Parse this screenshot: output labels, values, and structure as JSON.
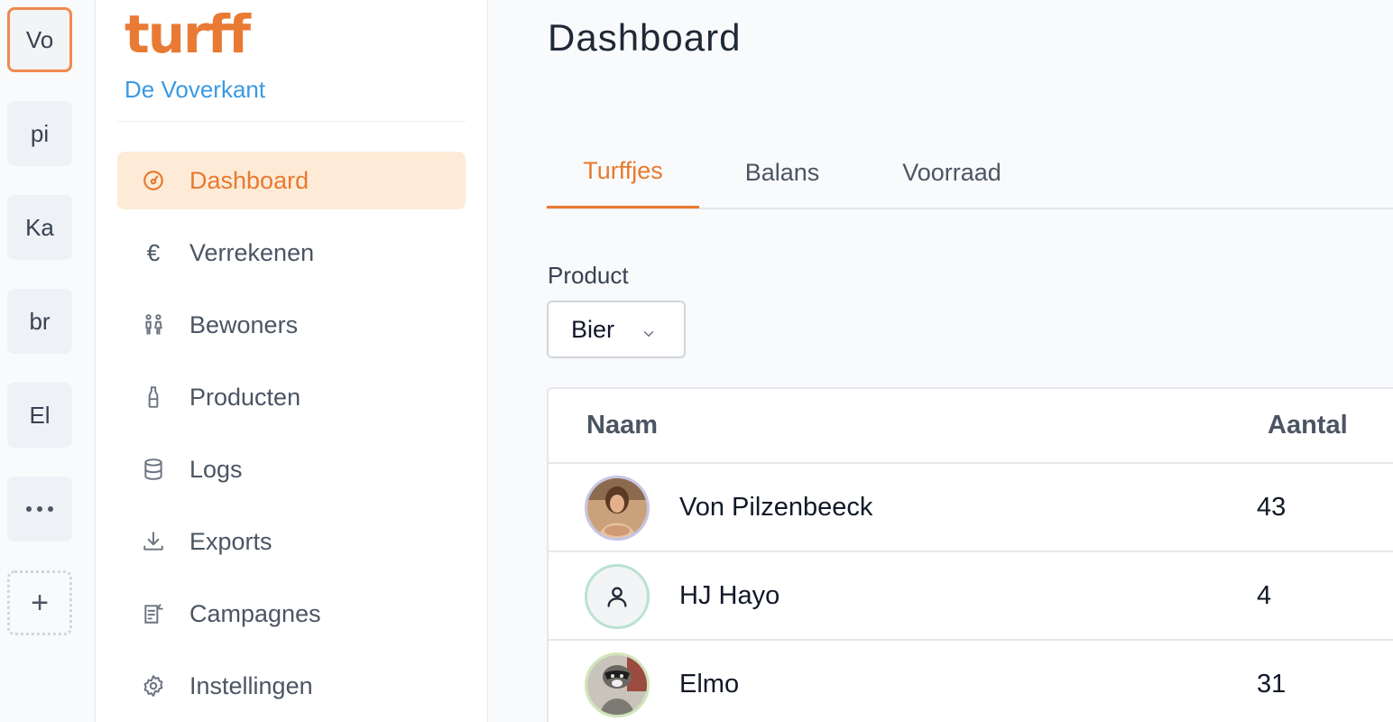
{
  "rail": {
    "groups": [
      {
        "abbr": "Vo",
        "active": true
      },
      {
        "abbr": "pi",
        "active": false
      },
      {
        "abbr": "Ka",
        "active": false
      },
      {
        "abbr": "br",
        "active": false
      },
      {
        "abbr": "El",
        "active": false
      }
    ],
    "more_icon": "ellipsis-icon",
    "add_icon": "plus-icon",
    "add_label": "+"
  },
  "sidebar": {
    "logo_text": "turff",
    "org_name": "De Voverkant",
    "nav": [
      {
        "label": "Dashboard",
        "icon": "gauge-icon",
        "active": true
      },
      {
        "label": "Verrekenen",
        "icon": "euro-icon",
        "icon_glyph": "€",
        "active": false
      },
      {
        "label": "Bewoners",
        "icon": "people-icon",
        "active": false
      },
      {
        "label": "Producten",
        "icon": "bottle-icon",
        "active": false
      },
      {
        "label": "Logs",
        "icon": "database-icon",
        "active": false
      },
      {
        "label": "Exports",
        "icon": "download-icon",
        "active": false
      },
      {
        "label": "Campagnes",
        "icon": "newspaper-icon",
        "active": false
      },
      {
        "label": "Instellingen",
        "icon": "gear-icon",
        "active": false
      }
    ]
  },
  "main": {
    "title": "Dashboard",
    "tabs": [
      {
        "label": "Turffjes",
        "active": true
      },
      {
        "label": "Balans",
        "active": false
      },
      {
        "label": "Voorraad",
        "active": false
      }
    ],
    "product_filter": {
      "label": "Product",
      "selected": "Bier"
    },
    "table": {
      "columns": [
        "Naam",
        "Aantal"
      ],
      "rows": [
        {
          "name": "Von Pilzenbeeck",
          "count": "43",
          "avatar": "photo-avatar"
        },
        {
          "name": "HJ Hayo",
          "count": "4",
          "avatar": "user-icon"
        },
        {
          "name": "Elmo",
          "count": "31",
          "avatar": "raccoon-photo-avatar"
        }
      ]
    }
  },
  "colors": {
    "accent": "#e9792f",
    "accent_bg": "#fdebd8",
    "org_blue": "#3b9ae1",
    "active_rail_border": "#ef8a4f"
  }
}
